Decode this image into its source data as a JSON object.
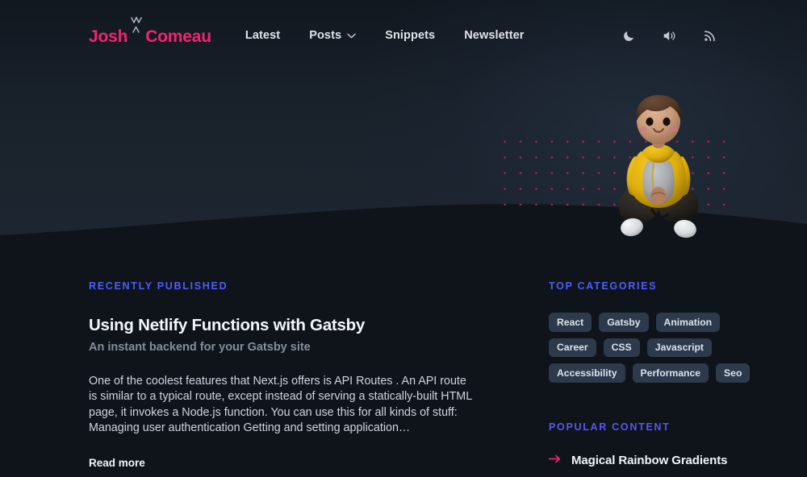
{
  "header": {
    "logo": {
      "first": "Josh",
      "last": "Comeau",
      "mark_icon": "wave-mark-icon",
      "color": "#f42272"
    },
    "nav": [
      {
        "label": "Latest",
        "has_dropdown": false
      },
      {
        "label": "Posts",
        "has_dropdown": true,
        "chevron_icon": "chevron-down-icon"
      },
      {
        "label": "Snippets",
        "has_dropdown": false
      },
      {
        "label": "Newsletter",
        "has_dropdown": false
      }
    ],
    "actions": [
      {
        "icon": "moon-icon",
        "name": "dark-mode-toggle"
      },
      {
        "icon": "speaker-icon",
        "name": "sound-toggle"
      },
      {
        "icon": "rss-icon",
        "name": "rss-feed-link"
      }
    ]
  },
  "hero": {
    "avatar_alt": "3d-avatar-sitting-cross-legged",
    "dot_grid_color": "#e8185f",
    "avatar": {
      "hair_color": "#4e3527",
      "skin_color": "#c79c80",
      "hoodie_color": "#e8b711",
      "shirt_color": "#a8a9ad",
      "pants_color": "#2a2723",
      "shoe_color": "#e4e7ea"
    }
  },
  "main": {
    "recent": {
      "label": "Recently Published",
      "post": {
        "title": "Using Netlify Functions with Gatsby",
        "subtitle": "An instant backend for your Gatsby site",
        "excerpt": "One of the coolest features that Next.js offers is API Routes . An API route is similar to a typical route, except instead of serving a statically-built HTML page, it invokes a Node.js function. You can use this for all kinds of stuff: Managing user authentication Getting and setting application…",
        "read_more": "Read more"
      }
    },
    "categories": {
      "label": "Top Categories",
      "tags": [
        "React",
        "Gatsby",
        "Animation",
        "Career",
        "CSS",
        "Javascript",
        "Accessibility",
        "Performance",
        "Seo"
      ]
    },
    "popular": {
      "label": "Popular Content",
      "items": [
        {
          "title": "Magical Rainbow Gradients",
          "arrow_icon": "arrow-right-icon"
        }
      ]
    }
  },
  "colors": {
    "page_background": "#0f141b",
    "hero_background": "#1b232d",
    "accent_pink": "#f42272",
    "accent_blue": "#4b5efc",
    "tag_background": "#2c3a4c"
  }
}
